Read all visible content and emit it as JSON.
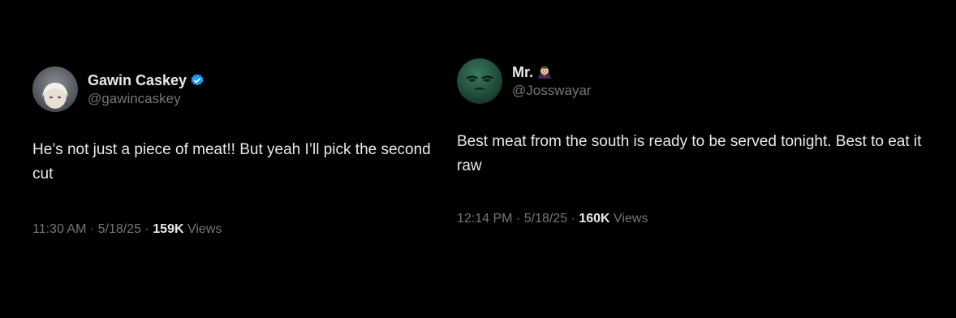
{
  "tweets": [
    {
      "name": "Gawin Caskey",
      "handle": "@gawincaskey",
      "verified_icon": "verified-badge-icon",
      "text": "He’s not just a piece of meat!! But yeah I’ll pick the second cut",
      "time": "11:30 AM",
      "date": "5/18/25",
      "views_count": "159K",
      "views_label": "Views"
    },
    {
      "name": "Mr.",
      "handle": "@Josswayar",
      "name_emoji_icon": "vampire-emoji-icon",
      "text": "Best meat from the south is ready to be served tonight. Best to eat it raw",
      "time": "12:14 PM",
      "date": "5/18/25",
      "views_count": "160K",
      "views_label": "Views"
    }
  ],
  "separator": "·",
  "colors": {
    "background": "#000000",
    "primary_text": "#e7e9ea",
    "secondary_text": "#71767b",
    "verified_blue": "#1d9bf0",
    "avatar_green": "#1f4a3a"
  }
}
